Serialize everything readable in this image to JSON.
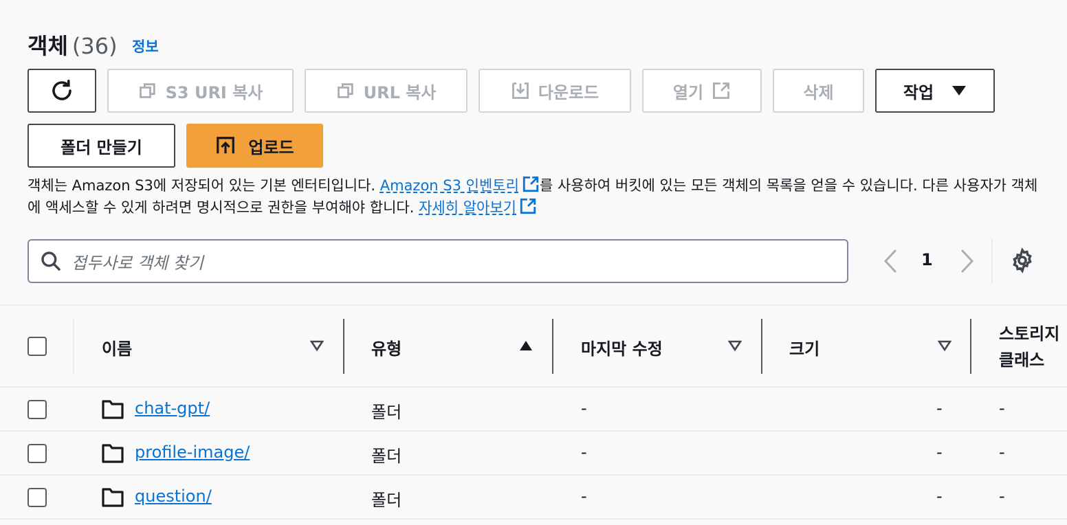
{
  "header": {
    "title": "객체",
    "count": "(36)",
    "info_link": "정보"
  },
  "toolbar": {
    "refresh_icon": "refresh-icon",
    "copy_s3_uri": "S3 URI 복사",
    "copy_url": "URL 복사",
    "download": "다운로드",
    "open": "열기",
    "delete": "삭제",
    "actions": "작업",
    "create_folder": "폴더 만들기",
    "upload": "업로드"
  },
  "description": {
    "part1": "객체는 Amazon S3에 저장되어 있는 기본 엔터티입니다. ",
    "link1": "Amazon S3 인벤토리",
    "part2": "를 사용하여 버킷에 있는 모든 객체의 목록을 얻을 수 있습니다. 다른 사용자가 객체에 액세스할 수 있게 하려면 명시적으로 권한을 부여해야 합니다. ",
    "link2": "자세히 알아보기"
  },
  "search": {
    "placeholder": "접두사로 객체 찾기"
  },
  "pagination": {
    "page": "1"
  },
  "table": {
    "columns": {
      "name": "이름",
      "type": "유형",
      "modified": "마지막 수정",
      "size": "크기",
      "storage_class_line1": "스토리지",
      "storage_class_line2": "클래스"
    },
    "rows": [
      {
        "name": "chat-gpt/",
        "type": "폴더",
        "modified": "-",
        "size": "-",
        "storage_class": "-"
      },
      {
        "name": "profile-image/",
        "type": "폴더",
        "modified": "-",
        "size": "-",
        "storage_class": "-"
      },
      {
        "name": "question/",
        "type": "폴더",
        "modified": "-",
        "size": "-",
        "storage_class": "-"
      }
    ]
  },
  "colors": {
    "accent": "#0972d3",
    "primary_button": "#f2a039",
    "background": "#f9f9fa"
  }
}
